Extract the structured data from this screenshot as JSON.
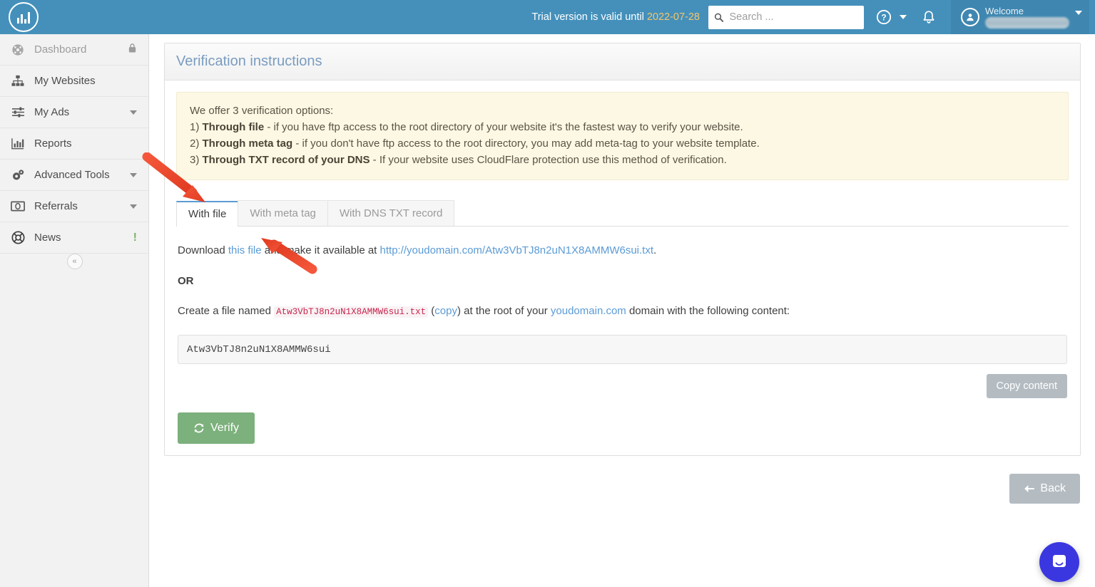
{
  "header": {
    "logo_icon": "bar-chart-logo-icon",
    "trial_prefix": "Trial version is valid until",
    "trial_date": "2022-07-28",
    "search_placeholder": "Search ...",
    "search_value": "",
    "search_icon": "search-icon",
    "help_icon": "question-circle-icon",
    "help_caret_icon": "chevron-down-icon",
    "bell_icon": "bell-icon",
    "avatar_icon": "user-avatar-icon",
    "welcome_label": "Welcome",
    "user_name": "",
    "user_caret_icon": "chevron-down-icon",
    "accent_blue": "#4490bb",
    "trial_date_color": "#f5c56b"
  },
  "sidebar": {
    "items": [
      {
        "label": "Dashboard",
        "icon": "dashboard-gauge-icon",
        "disabled": true,
        "badge": "lock",
        "chevron": false
      },
      {
        "label": "My Websites",
        "icon": "sitemap-icon",
        "disabled": false,
        "badge": "",
        "chevron": false
      },
      {
        "label": "My Ads",
        "icon": "sliders-icon",
        "disabled": false,
        "badge": "",
        "chevron": true
      },
      {
        "label": "Reports",
        "icon": "bar-chart-icon",
        "disabled": false,
        "badge": "",
        "chevron": false
      },
      {
        "label": "Advanced Tools",
        "icon": "gears-icon",
        "disabled": false,
        "badge": "",
        "chevron": true
      },
      {
        "label": "Referrals",
        "icon": "money-bill-icon",
        "disabled": false,
        "badge": "",
        "chevron": true
      },
      {
        "label": "News",
        "icon": "life-ring-icon",
        "disabled": false,
        "badge": "bang",
        "chevron": false
      }
    ],
    "collapse_label": "«",
    "badge_bang_color": "#7fb069"
  },
  "panel": {
    "title": "Verification instructions"
  },
  "alert": {
    "intro": "We offer 3 verification options:",
    "options": [
      {
        "num": "1)",
        "strong": "Through file",
        "rest": " - if you have ftp access to the root directory of your website it's the fastest way to verify your website."
      },
      {
        "num": "2)",
        "strong": "Through meta tag",
        "rest": " - if you don't have ftp access to the root directory, you may add meta-tag to your website template."
      },
      {
        "num": "3)",
        "strong": "Through TXT record of your DNS",
        "rest": " - If your website uses CloudFlare protection use this method of verification."
      }
    ],
    "bg_color": "#fcf8e3"
  },
  "tabs": [
    {
      "label": "With file",
      "active": true
    },
    {
      "label": "With meta tag",
      "active": false
    },
    {
      "label": "With DNS TXT record",
      "active": false
    }
  ],
  "content": {
    "download_prefix": "Download ",
    "download_link": "this file",
    "download_middle": " and make it available at ",
    "download_url": "http://youdomain.com/Atw3VbTJ8n2uN1X8AMMW6sui.txt",
    "download_suffix": ".",
    "or_label": "OR",
    "create_prefix": "Create a file named ",
    "file_name": "Atw3VbTJ8n2uN1X8AMMW6sui.txt",
    "copy_open": " (",
    "copy_link": "copy",
    "copy_close": ") ",
    "create_middle": "at the root of your ",
    "domain_link": "youdomain.com",
    "create_suffix": " domain with the following content:",
    "code_value": "Atw3VbTJ8n2uN1X8AMMW6sui",
    "copy_content_label": "Copy content",
    "verify_label": "Verify",
    "verify_icon": "refresh-icon",
    "back_label": "Back",
    "back_icon": "arrow-left-icon"
  },
  "annotations": {
    "arrow1": "red-arrow-pointing-to-with-file-tab",
    "arrow2": "red-arrow-pointing-to-this-file-link",
    "arrow_color": "#ef4b33"
  },
  "chat": {
    "launcher_icon": "intercom-chat-icon",
    "color": "#3b37e0"
  }
}
